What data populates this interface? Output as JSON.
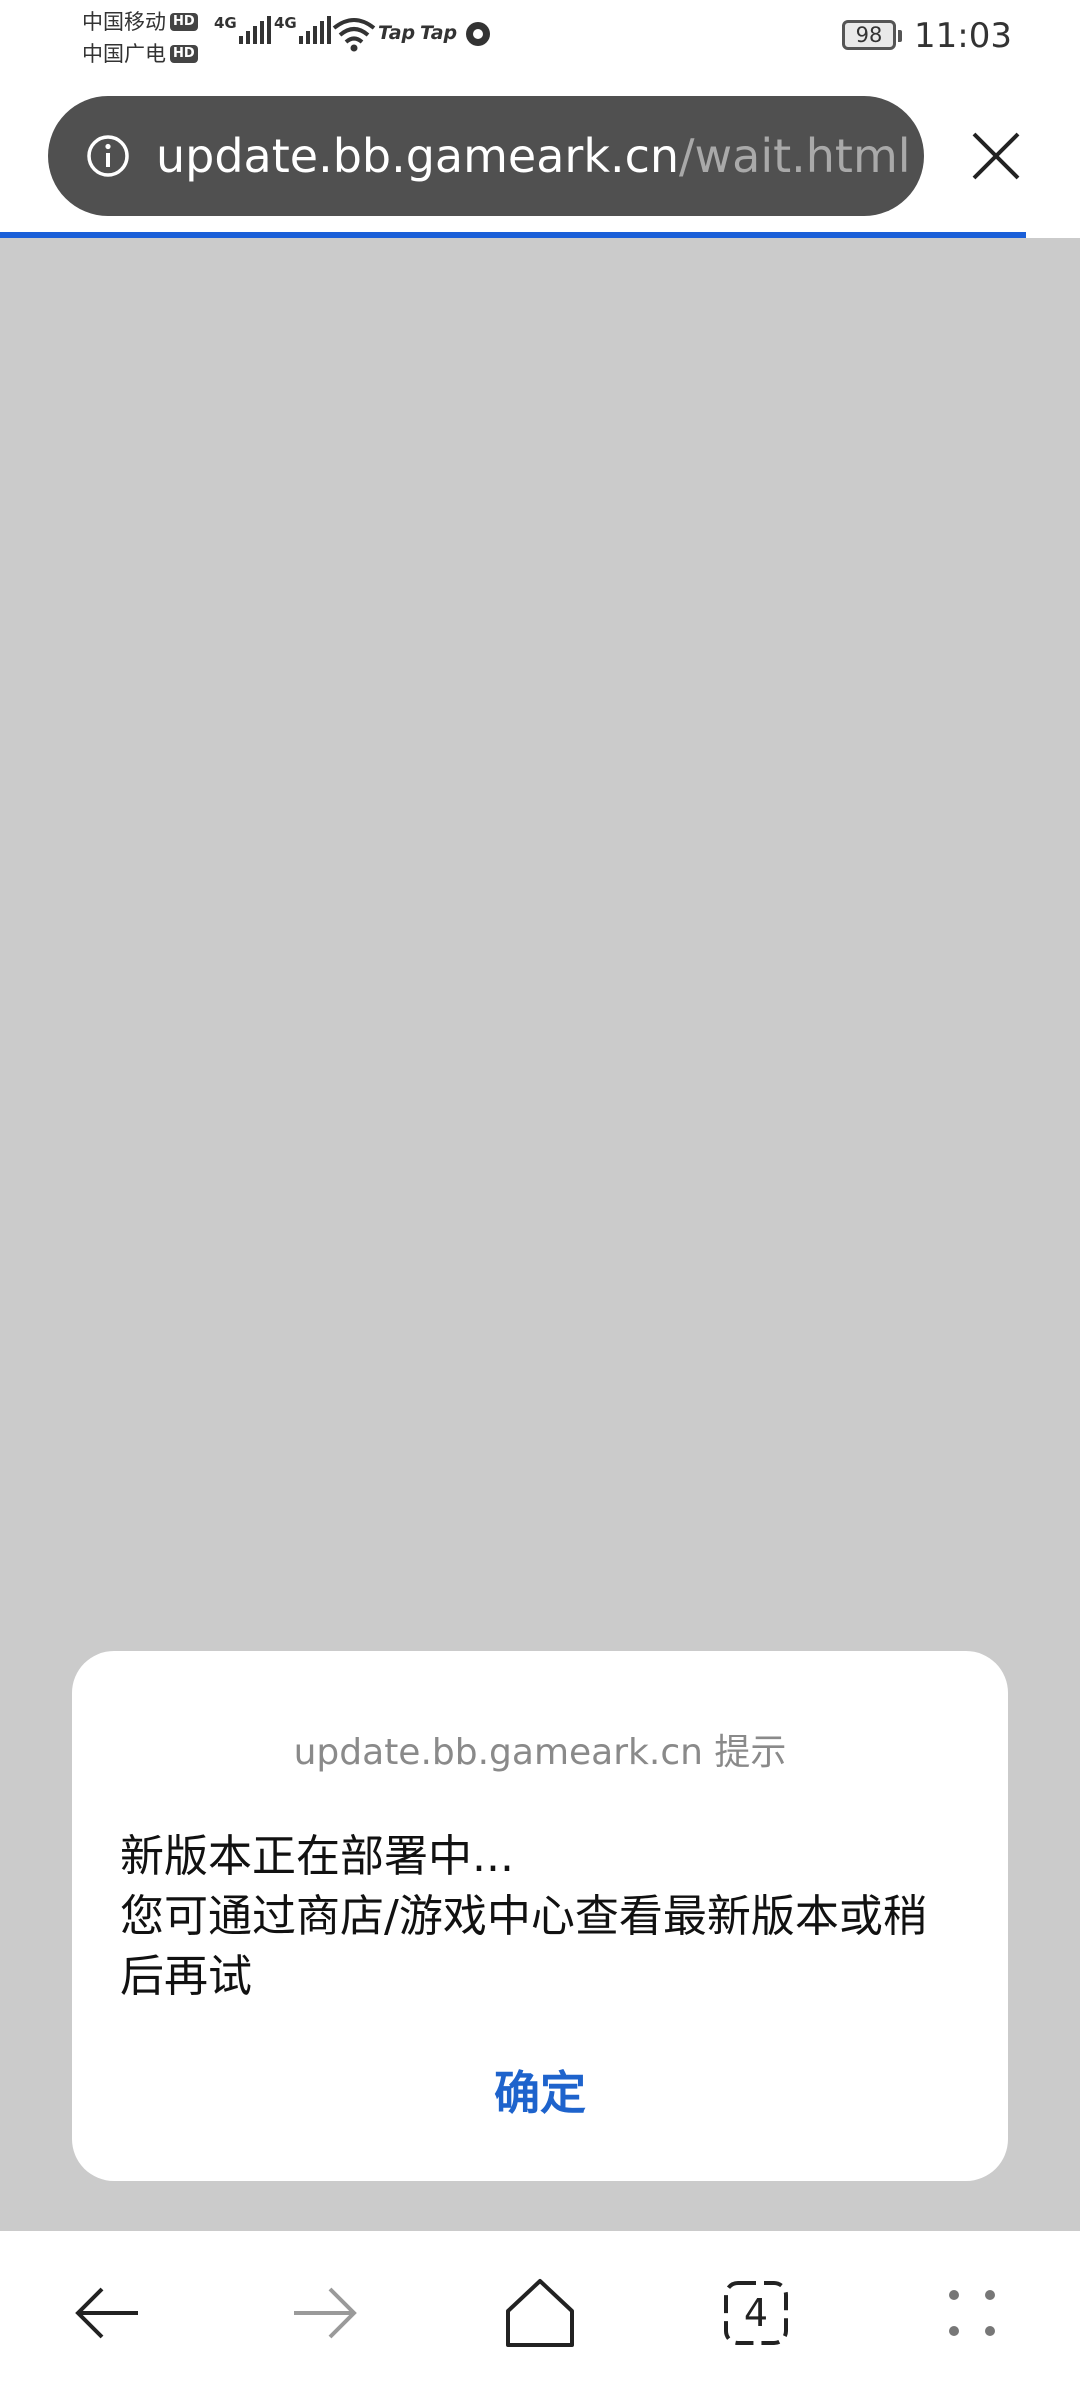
{
  "status_bar": {
    "carrier_1": "中国移动",
    "carrier_2": "中国广电",
    "hd_label": "HD",
    "net_type_1": "4G",
    "net_type_2": "4G",
    "tap_1": "Tap",
    "tap_2": "Tap",
    "battery": "98",
    "time": "11:03"
  },
  "browser": {
    "url_host": "update.bb.gameark.cn",
    "url_path": "/wait.html",
    "progress_fraction": 0.95
  },
  "dialog": {
    "title": "update.bb.gameark.cn 提示",
    "message_line_1": "新版本正在部署中...",
    "message_line_2": "您可通过商店/游戏中心查看最新版本或稍后再试",
    "confirm_label": "确定"
  },
  "bottom_nav": {
    "tab_count": "4"
  },
  "colors": {
    "accent": "#1e63cc",
    "progress": "#1a5fd8",
    "url_bar": "#505050",
    "page_bg": "#cbcbcb"
  }
}
